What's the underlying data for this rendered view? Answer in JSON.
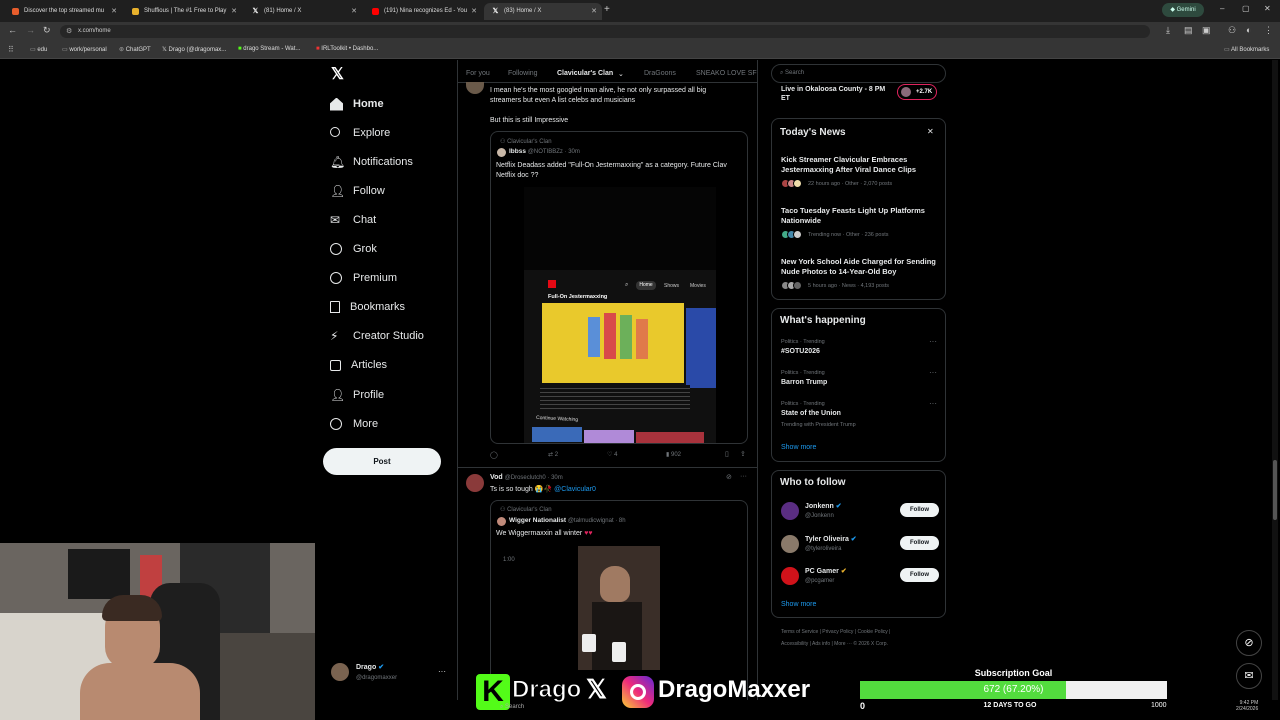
{
  "browser": {
    "tabs": [
      {
        "title": "Discover the top streamed mu",
        "icon": "music-icon",
        "color": "#e85d2c"
      },
      {
        "title": "Shuffious | The #1 Free to Play",
        "icon": "s-icon",
        "color": "#e8b12c"
      },
      {
        "title": "(81) Home / X",
        "icon": "x-icon",
        "color": "#000000"
      },
      {
        "title": "(191) Nina recognizes Ed - You",
        "icon": "youtube-icon",
        "color": "#ff0000"
      },
      {
        "title": "(83) Home / X",
        "icon": "x-icon",
        "color": "#000000"
      }
    ],
    "url": "x.com/home",
    "profile": "Gemini",
    "bookmarks": [
      {
        "label": "edu"
      },
      {
        "label": "work/personal"
      },
      {
        "label": "ChatGPT"
      },
      {
        "label": "Drago (@dragomax..."
      },
      {
        "label": "drago Stream - Wat..."
      },
      {
        "label": "IRLToolkit • Dashbo..."
      }
    ],
    "all_bookmarks": "All Bookmarks"
  },
  "sidebar": {
    "items": [
      {
        "label": "Home",
        "icon": "home-icon"
      },
      {
        "label": "Explore",
        "icon": "search-icon"
      },
      {
        "label": "Notifications",
        "icon": "bell-icon"
      },
      {
        "label": "Follow",
        "icon": "follow-icon"
      },
      {
        "label": "Chat",
        "icon": "chat-icon"
      },
      {
        "label": "Grok",
        "icon": "grok-icon"
      },
      {
        "label": "Premium",
        "icon": "premium-icon"
      },
      {
        "label": "Bookmarks",
        "icon": "bookmark-icon"
      },
      {
        "label": "Creator Studio",
        "icon": "creator-icon"
      },
      {
        "label": "Articles",
        "icon": "articles-icon"
      },
      {
        "label": "Profile",
        "icon": "profile-icon"
      },
      {
        "label": "More",
        "icon": "more-icon"
      }
    ],
    "post_label": "Post",
    "account_name": "Drago",
    "account_handle": "@dragomaxxer"
  },
  "feed": {
    "tabs": [
      "For you",
      "Following",
      "Clavicular's Clan",
      "DraGoons",
      "SNEAKO LOVE SF"
    ],
    "post1": {
      "text_line1": "I mean he's the most googled man alive, he not only surpassed all big",
      "text_line2": "streamers but even A list celebs and musicians",
      "text_line3": "But this is still Impressive",
      "quote_community": "Clavicular's Clan",
      "quote_author": "Ibbss",
      "quote_handle": "@NOTIBBZz · 30m",
      "quote_text": "Netflix Deadass added \"Full-On Jestermaxxing\" as a category. Future Clav Netflix doc ??",
      "screen_label": "Full-On Jestermaxxing",
      "screen_tabs": [
        "Home",
        "Shows",
        "Movies"
      ],
      "continue": "Continue Watching",
      "retweets": "2",
      "likes": "4",
      "views": "902"
    },
    "post2": {
      "name": "Vod",
      "handle": "@Droseclutch0 · 30m",
      "text": "Ts is so tough",
      "mention": "@Clavicular0",
      "quote_community": "Clavicular's Clan",
      "quote_author": "Wigger Nationalist",
      "quote_handle": "@talmudicwignat · 8h",
      "quote_text": "We Wiggermaxxin all winter",
      "timecode": "1:00"
    }
  },
  "right": {
    "search_placeholder": "Search",
    "live_title": "Live in Okaloosa County - 8 PM ET",
    "live_count": "+2.7K",
    "todays_news_title": "Today's News",
    "news": [
      {
        "title": "Kick Streamer Clavicular Embraces Jestermaxxing After Viral Dance Clips",
        "meta": "22 hours ago · Other · 2,070 posts"
      },
      {
        "title": "Taco Tuesday Feasts Light Up Platforms Nationwide",
        "meta": "Trending now · Other · 236 posts"
      },
      {
        "title": "New York School Aide Charged for Sending Nude Photos to 14-Year-Old Boy",
        "meta": "5 hours ago · News · 4,193 posts"
      }
    ],
    "happening_title": "What's happening",
    "trends": [
      {
        "category": "Politics · Trending",
        "name": "#SOTU2026",
        "sub": ""
      },
      {
        "category": "Politics · Trending",
        "name": "Barron Trump",
        "sub": ""
      },
      {
        "category": "Politics · Trending",
        "name": "State of the Union",
        "sub": "Trending with President Trump"
      }
    ],
    "show_more": "Show more",
    "follow_title": "Who to follow",
    "suggestions": [
      {
        "name": "Jonkenn",
        "handle": "@Jonkenn",
        "color": "#5a2d82"
      },
      {
        "name": "Tyler Oliveira",
        "handle": "@tyleroliveira",
        "color": "#8a7a6a"
      },
      {
        "name": "PC Gamer",
        "handle": "@pcgamer",
        "color": "#d0121a"
      }
    ],
    "follow_label": "Follow",
    "footer_line1": "Terms of Service | Privacy Policy | Cookie Policy |",
    "footer_line2": "Accessibility | Ads info | More ··· © 2026 X Corp."
  },
  "overlay": {
    "brand": "Drago",
    "insta": "DragoMaxxer",
    "goal_title": "Subscription Goal",
    "goal_text": "672 (67.20%)",
    "goal_progress": 0.672,
    "goal_min": "0",
    "goal_max": "1000",
    "goal_days": "12 DAYS TO GO"
  },
  "taskbar": {
    "search": "Search",
    "time": "9:42 PM",
    "date": "2/24/2026"
  }
}
